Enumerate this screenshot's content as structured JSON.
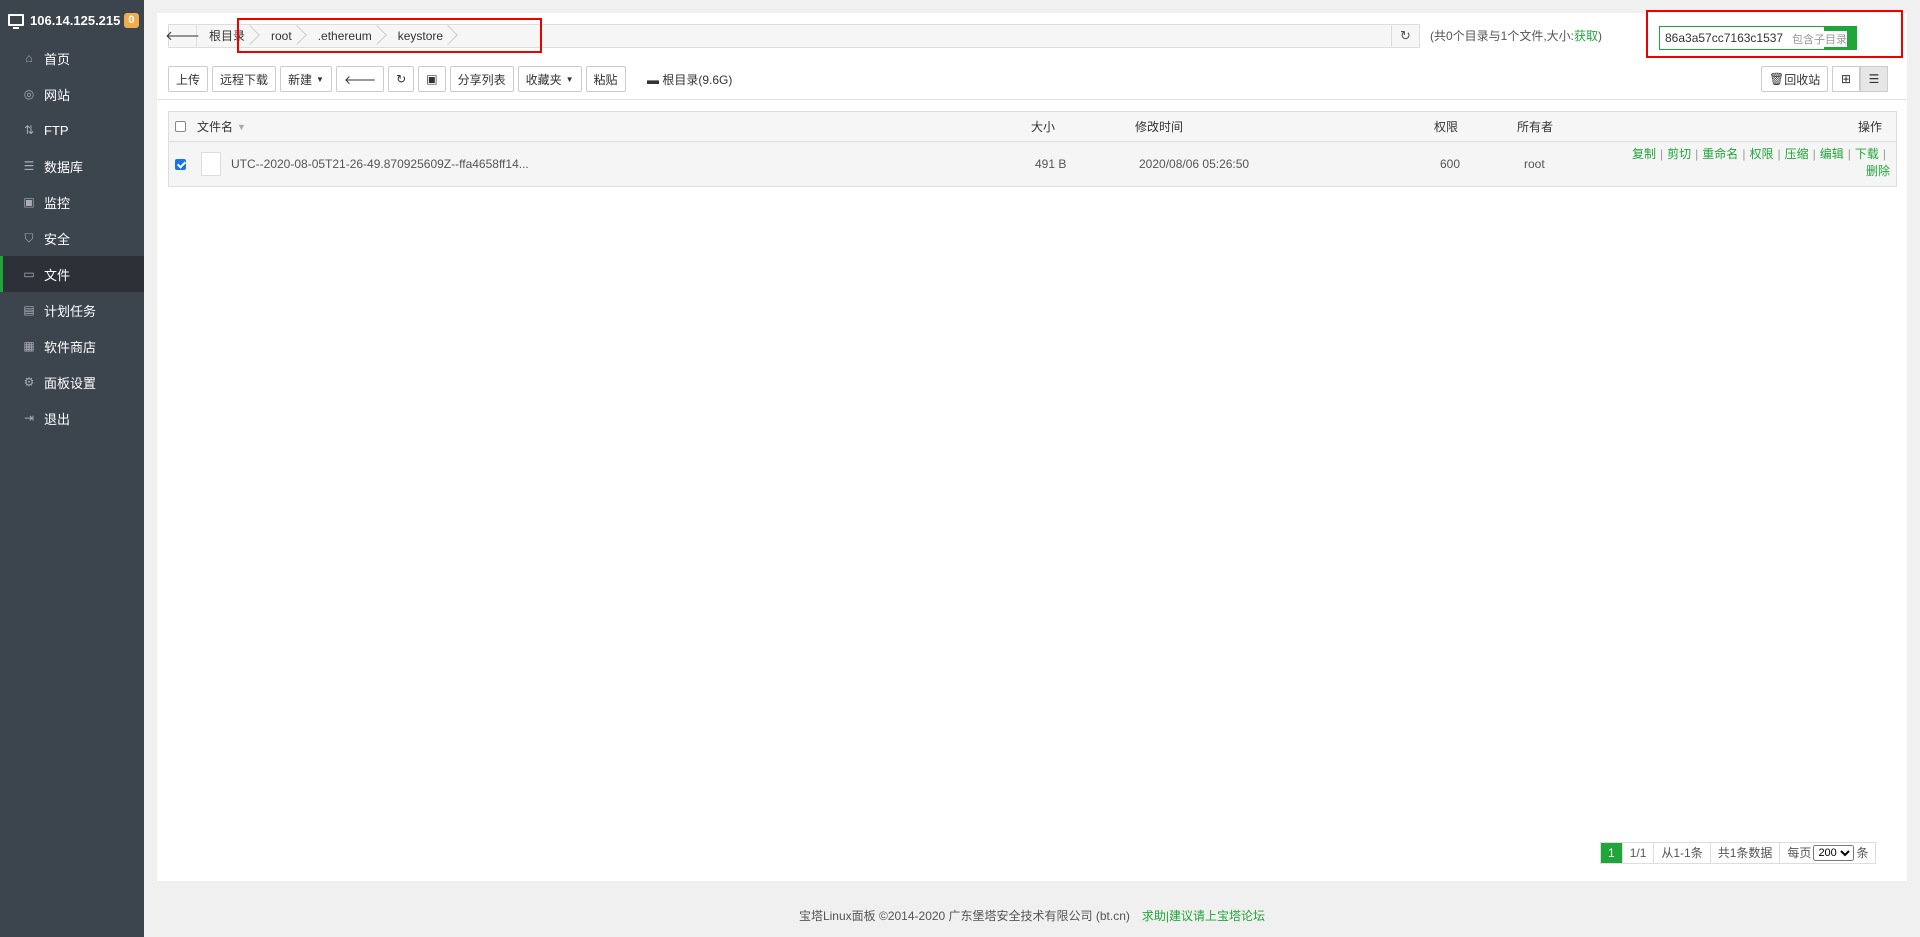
{
  "sidebar": {
    "host": "106.14.125.215",
    "badge": "0",
    "items": [
      {
        "label": "首页",
        "icon": "home-icon"
      },
      {
        "label": "网站",
        "icon": "globe-icon"
      },
      {
        "label": "FTP",
        "icon": "ftp-icon"
      },
      {
        "label": "数据库",
        "icon": "database-icon"
      },
      {
        "label": "监控",
        "icon": "monitor-icon"
      },
      {
        "label": "安全",
        "icon": "shield-icon"
      },
      {
        "label": "文件",
        "icon": "folder-icon"
      },
      {
        "label": "计划任务",
        "icon": "calendar-icon"
      },
      {
        "label": "软件商店",
        "icon": "apps-icon"
      },
      {
        "label": "面板设置",
        "icon": "gear-icon"
      },
      {
        "label": "退出",
        "icon": "logout-icon"
      }
    ],
    "active": "文件"
  },
  "breadcrumb": [
    "根目录",
    "root",
    ".ethereum",
    "keystore"
  ],
  "dir_info": {
    "text": "(共0个目录与1个文件,大小:",
    "link": "获取",
    "close": ")"
  },
  "search": {
    "value": "86a3a57cc7163c1537",
    "sub_label": "包含子目录"
  },
  "toolbar": {
    "upload": "上传",
    "remote_download": "远程下载",
    "new": "新建",
    "share_list": "分享列表",
    "favorites": "收藏夹",
    "paste": "粘贴",
    "disk": "根目录(9.6G)",
    "recycle": "回收站"
  },
  "table": {
    "headers": {
      "name": "文件名",
      "size": "大小",
      "mtime": "修改时间",
      "perm": "权限",
      "owner": "所有者",
      "ops": "操作"
    },
    "rows": [
      {
        "name": "UTC--2020-08-05T21-26-49.870925609Z--ffa4658ff14...",
        "size": "491 B",
        "mtime": "2020/08/06 05:26:50",
        "perm": "600",
        "owner": "root",
        "ops": [
          "复制",
          "剪切",
          "重命名",
          "权限",
          "压缩",
          "编辑",
          "下载",
          "删除"
        ]
      }
    ]
  },
  "pager": {
    "current": "1",
    "pages": "1/1",
    "range": "从1-1条",
    "total": "共1条数据",
    "per_page_label": "每页",
    "per_page": "200",
    "unit": "条"
  },
  "footer": {
    "copyright": "宝塔Linux面板 ©2014-2020 广东堡塔安全技术有限公司 (bt.cn)",
    "link": "求助|建议请上宝塔论坛"
  },
  "colors": {
    "accent": "#20a53a",
    "sidebar": "#3c444d",
    "highlight": "#e00000"
  }
}
